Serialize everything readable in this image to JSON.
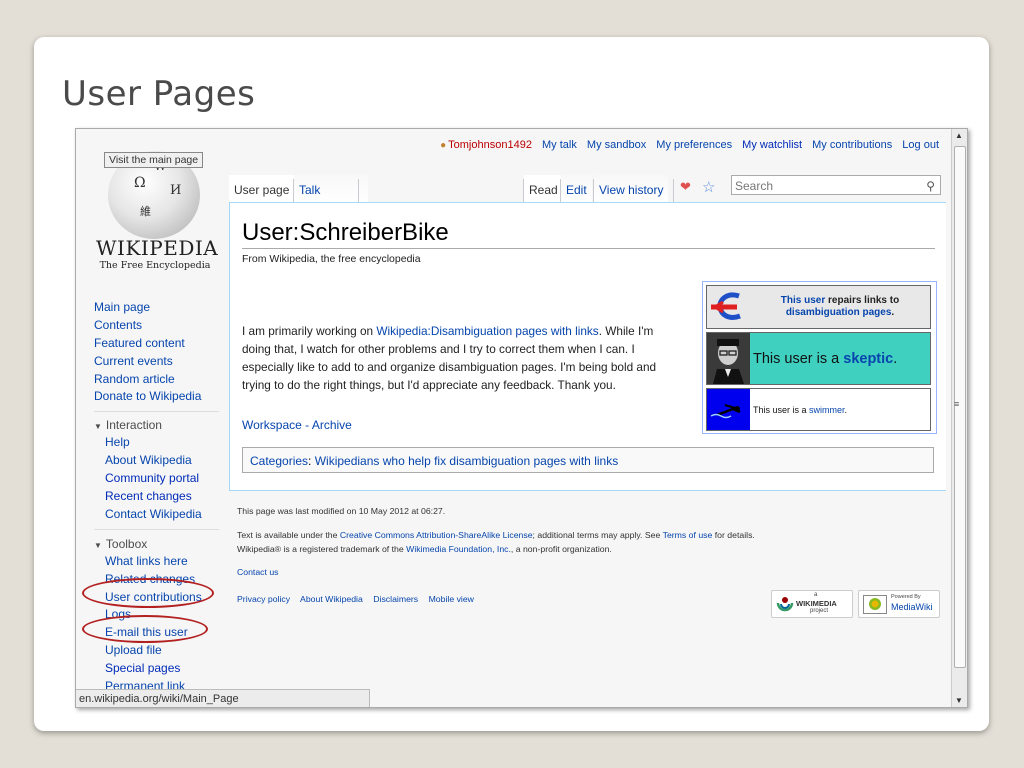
{
  "slide": {
    "title": "User Pages"
  },
  "personal": {
    "username": "Tomjohnson1492",
    "links": [
      "My talk",
      "My sandbox",
      "My preferences",
      "My watchlist",
      "My contributions",
      "Log out"
    ]
  },
  "logo": {
    "tooltip": "Visit the main page",
    "wordmark": "WIKIPEDIA",
    "tagline": "The Free Encyclopedia",
    "glyphs": [
      "Ω",
      "W",
      "И",
      "維"
    ]
  },
  "sidebar": {
    "main": [
      "Main page",
      "Contents",
      "Featured content",
      "Current events",
      "Random article",
      "Donate to Wikipedia"
    ],
    "interaction_label": "Interaction",
    "interaction": [
      "Help",
      "About Wikipedia",
      "Community portal",
      "Recent changes",
      "Contact Wikipedia"
    ],
    "toolbox_label": "Toolbox",
    "toolbox": [
      "What links here",
      "Related changes",
      "User contributions",
      "Logs",
      "E-mail this user",
      "Upload file",
      "Special pages",
      "Permanent link"
    ]
  },
  "tabs": {
    "left": [
      "User page",
      "Talk"
    ],
    "right": [
      "Read",
      "Edit",
      "View history"
    ]
  },
  "search": {
    "placeholder": "Search"
  },
  "page": {
    "title": "User:SchreiberBike",
    "tagline": "From Wikipedia, the free encyclopedia",
    "para_before": "I am primarily working on ",
    "para_link": "Wikipedia:Disambiguation pages with links",
    "para_after": ". While I'm doing that, I watch for other problems and I try to correct them when I can. I especially like to add to and organize disambiguation pages. I'm being bold and trying to do the right things, but I'd appreciate any feedback. Thank you.",
    "workspace": "Workspace",
    "workspace_sep": " - ",
    "archive": "Archive",
    "categories_label": "Categories",
    "categories_sep": ": ",
    "category": "Wikipedians who help fix disambiguation pages with links"
  },
  "userboxes": {
    "repair_link": "This user",
    "repair_text": " repairs links to",
    "repair_link2": "disambiguation pages",
    "repair_dot": ".",
    "skeptic_text": "This user is a ",
    "skeptic_link": "skeptic",
    "skeptic_dot": ".",
    "swimmer_text": "This user is a ",
    "swimmer_link": "swimmer",
    "swimmer_dot": "."
  },
  "footer": {
    "modified": "This page was last modified on 10 May 2012 at 06:27.",
    "license_1": "Text is available under the ",
    "license_link": "Creative Commons Attribution-ShareAlike License",
    "license_2": "; additional terms may apply.  See ",
    "terms_link": "Terms of use",
    "license_3": " for details.",
    "trademark_1": "Wikipedia® is a registered trademark of the ",
    "foundation_link": "Wikimedia Foundation, Inc.",
    "trademark_2": ", a non-profit organization.",
    "contact": "Contact us",
    "links": [
      "Privacy policy",
      "About Wikipedia",
      "Disclaimers",
      "Mobile view"
    ],
    "badge_wikimedia_pre": "a",
    "badge_wikimedia": "WIKIMEDIA",
    "badge_wikimedia_post": "project",
    "badge_mediawiki_pre": "Powered By",
    "badge_mediawiki": "MediaWiki"
  },
  "status_bar": "en.wikipedia.org/wiki/Main_Page",
  "colors": {
    "link": "#0645ad",
    "annotation": "#b32020",
    "skeptic_bg": "#40d0c0",
    "swimmer_icon_bg": "#0000ee"
  }
}
